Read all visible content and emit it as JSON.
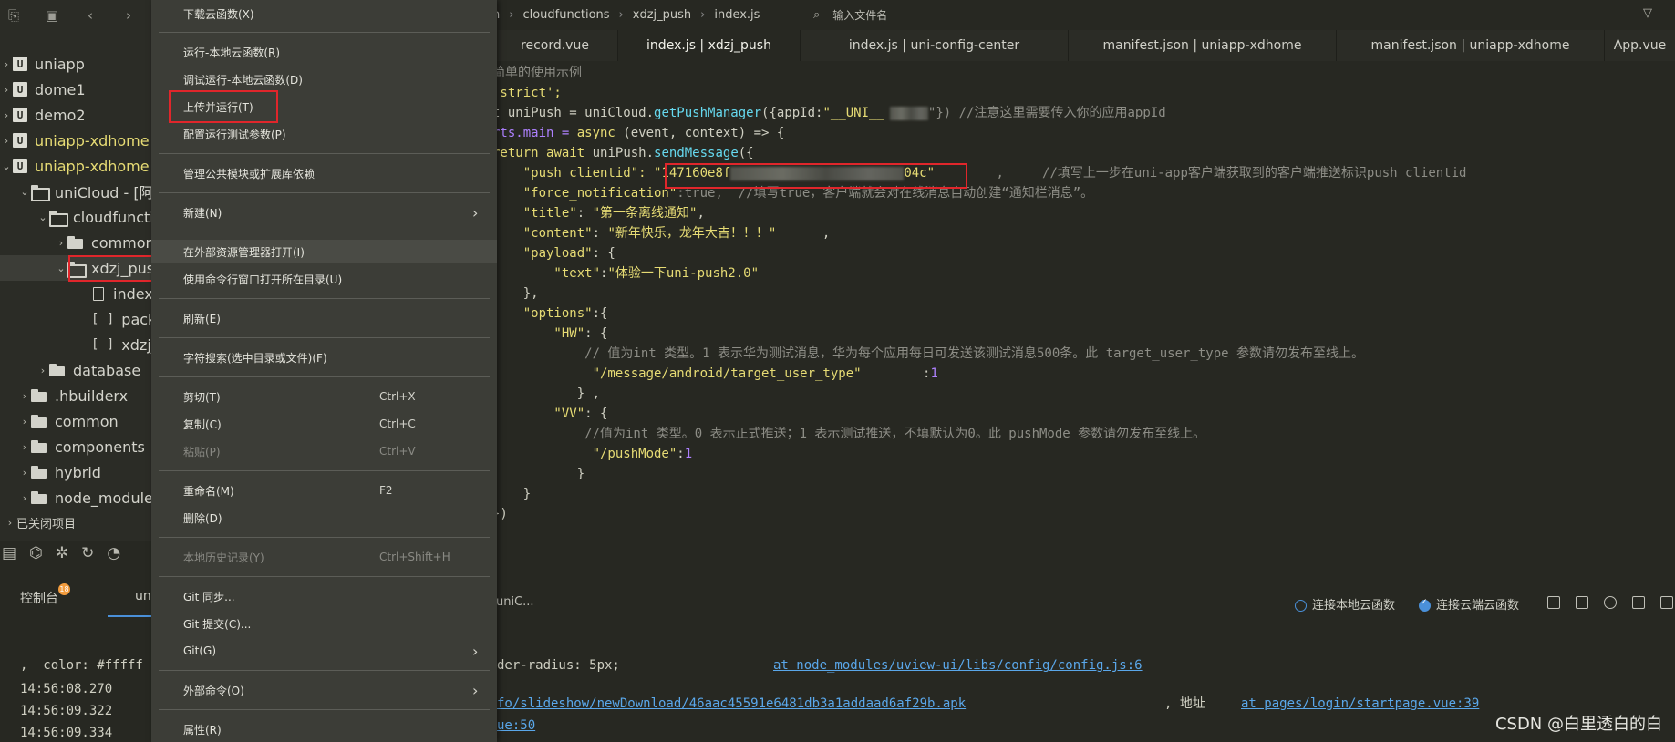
{
  "sidebar": {
    "toolbar_icons": [
      "new-file-icon",
      "save-icon",
      "back-icon",
      "forward-icon"
    ],
    "tree": [
      {
        "label": "uniapp",
        "type": "project"
      },
      {
        "label": "dome1",
        "type": "project"
      },
      {
        "label": "demo2",
        "type": "project"
      },
      {
        "label": "uniapp-xdhome",
        "type": "project",
        "highlight": true
      },
      {
        "label": "uniapp-xdhome",
        "type": "project",
        "highlight": true,
        "expanded": true
      },
      {
        "label": "uniCloud - [阿",
        "type": "folder"
      },
      {
        "label": "cloudfuncti",
        "type": "folder"
      },
      {
        "label": "commor",
        "type": "folder"
      },
      {
        "label": "xdzj_pus",
        "type": "folder",
        "selected": true
      },
      {
        "label": "index",
        "type": "file"
      },
      {
        "label": "packa",
        "type": "json"
      },
      {
        "label": "xdzj_",
        "type": "json"
      },
      {
        "label": "database",
        "type": "folder"
      },
      {
        "label": ".hbuilderx",
        "type": "folder"
      },
      {
        "label": "common",
        "type": "folder"
      },
      {
        "label": "components",
        "type": "folder"
      },
      {
        "label": "hybrid",
        "type": "folder"
      },
      {
        "label": "node_module",
        "type": "folder"
      }
    ],
    "closed_projects": "已关闭项目",
    "bottom_tools": [
      "console-icon",
      "binoculars-icon",
      "debug-icon",
      "refresh-icon",
      "palette-icon"
    ],
    "console_tab": "控制台",
    "console_badge": "18",
    "second_tab": "un"
  },
  "editor": {
    "breadcrumb": [
      "n",
      "cloudfunctions",
      "xdzj_push",
      "index.js"
    ],
    "file_search_placeholder": "输入文件名",
    "tabs": [
      "record.vue",
      "index.js | xdzj_push",
      "index.js | uni-config-center",
      "manifest.json | uniapp-xdhome",
      "manifest.json | uniapp-xdhome",
      "App.vue"
    ],
    "active_tab": "index.js | xdzj_push",
    "code": {
      "l1": "简单的使用示例",
      "l2": " strict';",
      "l3a": "t uniPush = uniCloud.",
      "l3b": "getPushManager",
      "l3c": "({appId:",
      "l3d": "\"__UNI__",
      "l3e": "\"}) //注意这里需要传入你的应用appId",
      "l4a": "rts.main = ",
      "l4b": "async",
      "l4c": " (event, context) => {",
      "l5a": "return ",
      "l5b": "await",
      "l5c": " uniPush.",
      "l5d": "sendMessage",
      "l5e": "({",
      "l6a": "    \"push_clientid\": ",
      "l6b": "\"147160e8f",
      "l6c": "04c\"",
      "l6d": "        ,     //填写上一步在uni-app客户端获取到的客户端推送标识push_clientid",
      "l7a": "    \"force_notification\"",
      "l7b": ":true,  //填写true，客户端就会对在线消息自动创建“通知栏消息”。",
      "l8a": "    \"title\"",
      "l8b": ": ",
      "l8c": "\"第一条离线通知\"",
      "l8d": ",",
      "l9a": "    \"content\"",
      "l9b": ": ",
      "l9c": "\"新年快乐，龙年大吉！！！\"",
      "l9d": "      ,",
      "l10a": "    \"payload\"",
      "l10b": ": {",
      "l11a": "        \"text\"",
      "l11b": ":",
      "l11c": "\"体验一下uni-push2.0\"",
      "l12": "    },",
      "l13a": "    \"options\"",
      "l13b": ":{",
      "l14a": "        \"HW\"",
      "l14b": ": {",
      "l15": "            // 值为int 类型。1 表示华为测试消息，华为每个应用每日可发送该测试消息500条。此 target_user_type 参数请勿发布至线上。",
      "l16a": "             \"/message/android/target_user_type\"",
      "l16b": "        :",
      "l16c": "1",
      "l17": "           } ,",
      "l18a": "        \"VV\"",
      "l18b": ": {",
      "l19": "            //值为int 类型。0 表示正式推送；1 表示测试推送，不填默认为0。此 pushMode 参数请勿发布至线上。",
      "l20a": "             \"/pushMode\"",
      "l20b": ":",
      "l20c": "1",
      "l21": "           }",
      "l22": "    }",
      "l23": "})"
    }
  },
  "console": {
    "tab_partial": "uniC...",
    "radio_local": "连接本地云函数",
    "radio_cloud": "连接云端云函数",
    "lines": {
      "o1a": ",  color: #fffff",
      "o1b": "der-radius: 5px;",
      "o1c": "at node_modules/uview-ui/libs/config/config.js:6",
      "o2a": "14:56:08.270",
      "o3a": "14:56:09.322",
      "o3b": "fo/slideshow/newDownload/46aac45591e6481db3a1addaad6af29b.apk",
      "o3c": ", 地址",
      "o3d": "at pages/login/startpage.vue:39",
      "o4a": "14:56:09.334",
      "o4b": "ue:50"
    }
  },
  "context_menu": {
    "items": {
      "download": "下载云函数(X)",
      "run_local": "运行-本地云函数(R)",
      "debug_local": "调试运行-本地云函数(D)",
      "upload_run": "上传并运行(T)",
      "config_params": "配置运行测试参数(P)",
      "manage_deps": "管理公共模块或扩展库依赖",
      "new": "新建(N)",
      "open_explorer": "在外部资源管理器打开(I)",
      "open_terminal": "使用命令行窗口打开所在目录(U)",
      "refresh": "刷新(E)",
      "search": "字符搜索(选中目录或文件)(F)",
      "cut": "剪切(T)",
      "cut_sc": "Ctrl+X",
      "copy": "复制(C)",
      "copy_sc": "Ctrl+C",
      "paste": "粘贴(P)",
      "paste_sc": "Ctrl+V",
      "rename": "重命名(M)",
      "rename_sc": "F2",
      "delete": "删除(D)",
      "history": "本地历史记录(Y)",
      "history_sc": "Ctrl+Shift+H",
      "git_sync": "Git 同步...",
      "git_commit": "Git 提交(C)...",
      "git": "Git(G)",
      "external": "外部命令(O)",
      "properties": "属性(R)"
    }
  },
  "watermark": "CSDN @白里透白的白",
  "colors": {
    "highlight_box": "#e0262b",
    "string": "#e6db74",
    "link": "#5aa7ea",
    "badge": "#f39c3d"
  }
}
